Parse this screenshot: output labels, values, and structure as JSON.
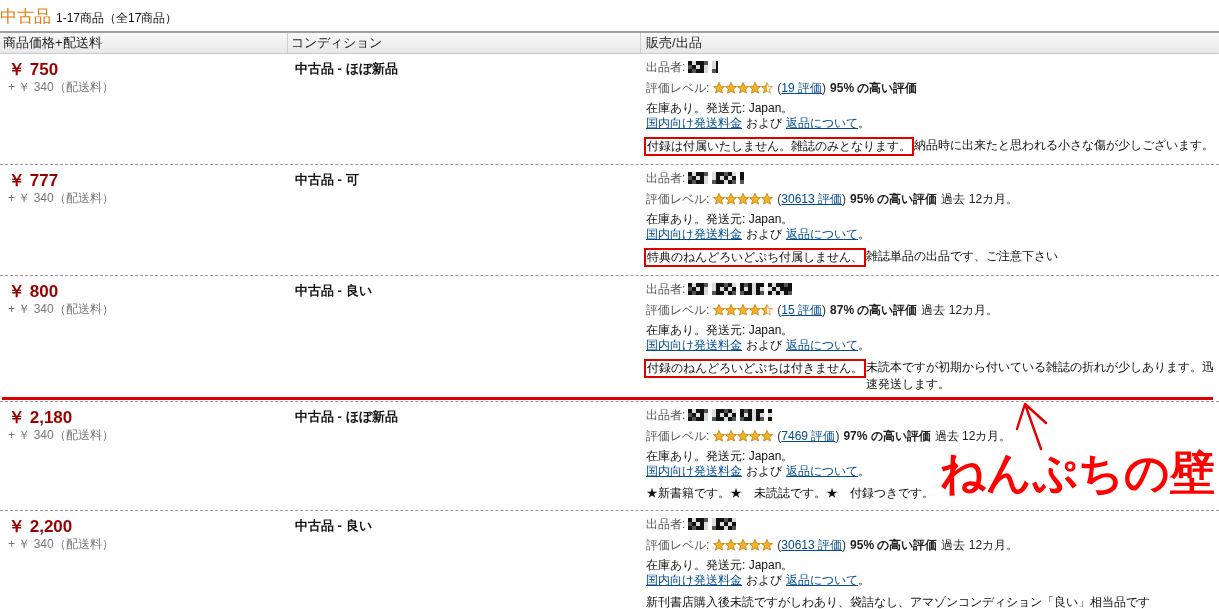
{
  "header": {
    "title": "中古品",
    "count": "1-17商品（全17商品）"
  },
  "table": {
    "columns": [
      "商品価格+配送料",
      "コンディション",
      "販売/出品"
    ],
    "rows": [
      {
        "price": "￥ 750",
        "shipping": "+ ￥ 340（配送料）",
        "condition": "中古品 - ほぼ新品",
        "seller_label": "出品者:",
        "rating": {
          "label": "評価レベル:",
          "stars": 4.5,
          "open": "(",
          "reviews": "19 評価",
          "close": ")",
          "score": "95% の高い評価"
        },
        "stock": "在庫あり。発送元: Japan。",
        "links": {
          "shipping": "国内向け発送料金",
          "and": "および",
          "returns": "返品について",
          "end": "。"
        },
        "comment": [
          {
            "text": "付録は付属いたしません。雑誌のみとなります。",
            "boxed": true
          },
          {
            "text": "納品時に出来たと思われる小さな傷が少しございます。",
            "boxed": false
          }
        ],
        "wall_below": false
      },
      {
        "price": "￥ 777",
        "shipping": "+ ￥ 340（配送料）",
        "condition": "中古品 - 可",
        "seller_label": "出品者:",
        "rating": {
          "label": "評価レベル:",
          "stars": 5,
          "open": "(",
          "reviews": "30613 評価",
          "close": ")",
          "score": "95% の高い評価",
          "period": "過去 12カ月。"
        },
        "stock": "在庫あり。発送元: Japan。",
        "links": {
          "shipping": "国内向け発送料金",
          "and": "および",
          "returns": "返品について",
          "end": "。"
        },
        "comment": [
          {
            "text": "特典のねんどろいどぷち付属しません、",
            "boxed": true
          },
          {
            "text": "雑誌単品の出品です、ご注意下さい",
            "boxed": false
          }
        ],
        "wall_below": false
      },
      {
        "price": "￥ 800",
        "shipping": "+ ￥ 340（配送料）",
        "condition": "中古品 - 良い",
        "seller_label": "出品者:",
        "rating": {
          "label": "評価レベル:",
          "stars": 4.5,
          "open": "(",
          "reviews": "15 評価",
          "close": ")",
          "score": "87% の高い評価",
          "period": "過去 12カ月。"
        },
        "stock": "在庫あり。発送元: Japan。",
        "links": {
          "shipping": "国内向け発送料金",
          "and": "および",
          "returns": "返品について",
          "end": "。"
        },
        "comment": [
          {
            "text": "付録のねんどろいどぷちは付きません。",
            "boxed": true
          },
          {
            "text": "未読本ですが初期から付いている雑誌の折れが少しあります。迅速発送します。",
            "boxed": false
          }
        ],
        "wall_below": true
      },
      {
        "price": "￥ 2,180",
        "shipping": "+ ￥ 340（配送料）",
        "condition": "中古品 - ほぼ新品",
        "seller_label": "出品者:",
        "rating": {
          "label": "評価レベル:",
          "stars": 5,
          "open": "(",
          "reviews": "7469 評価",
          "close": ")",
          "score": "97% の高い評価",
          "period": "過去 12カ月。"
        },
        "stock": "在庫あり。発送元: Japan。",
        "links": {
          "shipping": "国内向け発送料金",
          "and": "および",
          "returns": "返品について",
          "end": "。"
        },
        "comment": [
          {
            "text": "★新書籍です。★　未読誌です。★　付録つきです。",
            "boxed": false
          }
        ],
        "wall_below": false
      },
      {
        "price": "￥ 2,200",
        "shipping": "+ ￥ 340（配送料）",
        "condition": "中古品 - 良い",
        "seller_label": "出品者:",
        "rating": {
          "label": "評価レベル:",
          "stars": 5,
          "open": "(",
          "reviews": "30613 評価",
          "close": ")",
          "score": "95% の高い評価",
          "period": "過去 12カ月。"
        },
        "stock": "在庫あり。発送元: Japan。",
        "links": {
          "shipping": "国内向け発送料金",
          "and": "および",
          "returns": "返品について",
          "end": "。"
        },
        "comment": [
          {
            "text": "新刊書店購入後未読ですがしわあり、袋詰なし、アマゾンコンディション「良い」相当品です",
            "boxed": false
          }
        ],
        "wall_below": false
      }
    ]
  },
  "annotation": {
    "text": "ねんぷちの壁"
  }
}
